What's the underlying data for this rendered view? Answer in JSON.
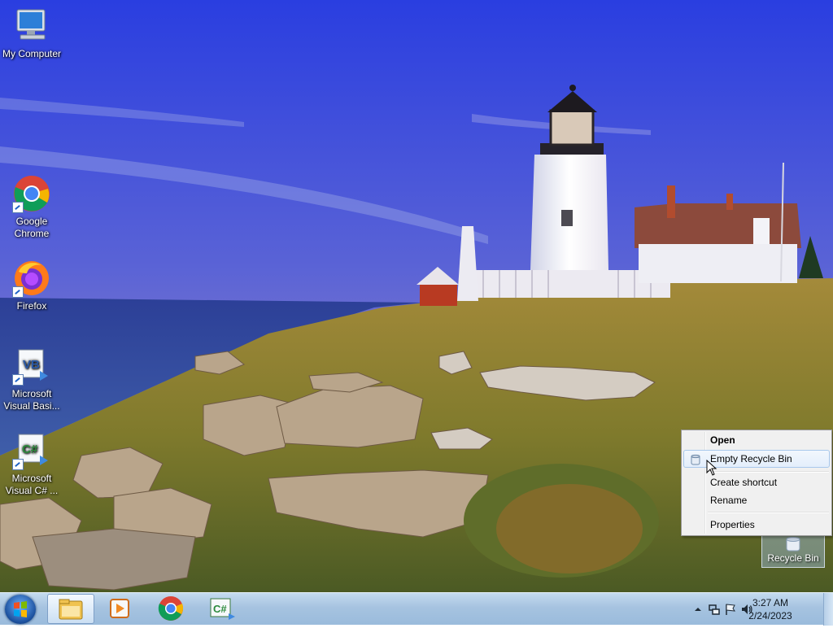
{
  "desktop": {
    "icons": [
      {
        "label": "My Computer",
        "icon": "computer-icon"
      },
      {
        "label": "Google\nChrome",
        "icon": "chrome-icon"
      },
      {
        "label": "Firefox",
        "icon": "firefox-icon"
      },
      {
        "label": "Microsoft\nVisual Basi...",
        "icon": "visual-basic-icon"
      },
      {
        "label": "Microsoft\nVisual C# ...",
        "icon": "visual-csharp-icon"
      }
    ],
    "recycle_bin": {
      "label": "Recycle Bin",
      "icon": "recycle-bin-icon"
    }
  },
  "context_menu": {
    "items": [
      {
        "label": "Open",
        "bold": true
      },
      {
        "label": "Empty Recycle Bin",
        "highlighted": true,
        "icon": "recycle-bin-icon"
      },
      {
        "label": "Create shortcut"
      },
      {
        "label": "Rename"
      },
      {
        "label": "Properties"
      }
    ]
  },
  "taskbar": {
    "start_icon": "windows-logo-icon",
    "pinned": [
      {
        "icon": "file-explorer-icon",
        "active": true
      },
      {
        "icon": "media-player-icon"
      },
      {
        "icon": "chrome-icon"
      },
      {
        "icon": "visual-csharp-icon"
      }
    ],
    "tray": {
      "icons": [
        "show-hidden-icons-chevron",
        "network-icon",
        "action-center-flag-icon",
        "volume-icon"
      ],
      "time": "3:27 AM",
      "date": "2/24/2023"
    }
  },
  "colors": {
    "taskbar": "#a6c3e0",
    "menu_background": "#f0f0f0",
    "menu_highlight_border": "#a8c8ec"
  }
}
